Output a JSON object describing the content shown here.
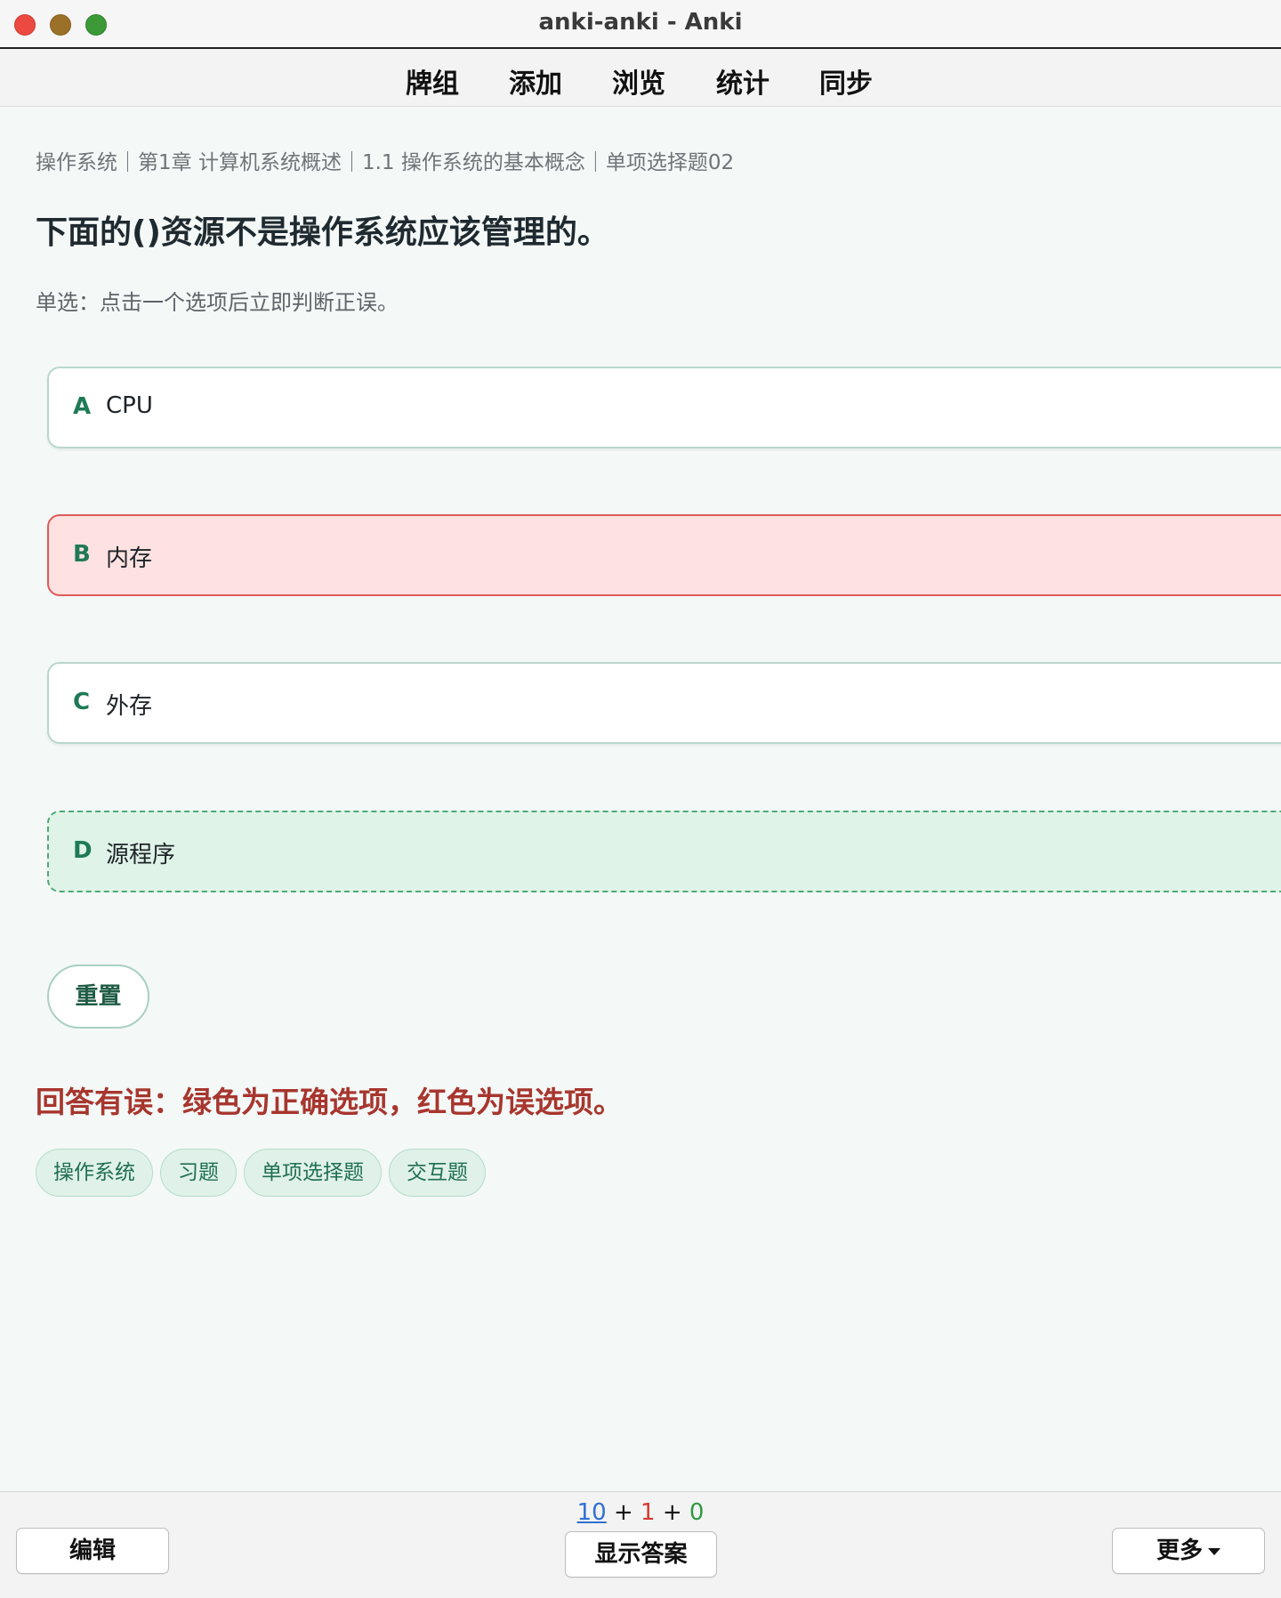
{
  "window": {
    "title": "anki-anki - Anki"
  },
  "toolbar": {
    "items": [
      {
        "label": "牌组"
      },
      {
        "label": "添加"
      },
      {
        "label": "浏览"
      },
      {
        "label": "统计"
      },
      {
        "label": "同步"
      }
    ]
  },
  "card": {
    "breadcrumb": "操作系统｜第1章 计算机系统概述｜1.1 操作系统的基本概念｜单项选择题02",
    "question": "下面的()资源不是操作系统应该管理的。",
    "hint": "单选：点击一个选项后立即判断正误。",
    "options": [
      {
        "letter": "A",
        "text": "CPU",
        "state": "default"
      },
      {
        "letter": "B",
        "text": "内存",
        "state": "wrong-selected"
      },
      {
        "letter": "C",
        "text": "外存",
        "state": "default"
      },
      {
        "letter": "D",
        "text": "源程序",
        "state": "correct"
      }
    ],
    "reset_label": "重置",
    "feedback": "回答有误：绿色为正确选项，红色为误选项。",
    "tags": [
      "操作系统",
      "习题",
      "单项选择题",
      "交互题"
    ]
  },
  "bottombar": {
    "edit_label": "编辑",
    "show_answer_label": "显示答案",
    "more_label": "更多",
    "counts": {
      "new": "10",
      "learn": "1",
      "review": "0",
      "sep": "+"
    }
  },
  "colors": {
    "correct_bg": "#dff3e8",
    "wrong_bg": "#fde2e1",
    "accent_green": "#1e7a55",
    "feedback_red": "#a7362e"
  }
}
